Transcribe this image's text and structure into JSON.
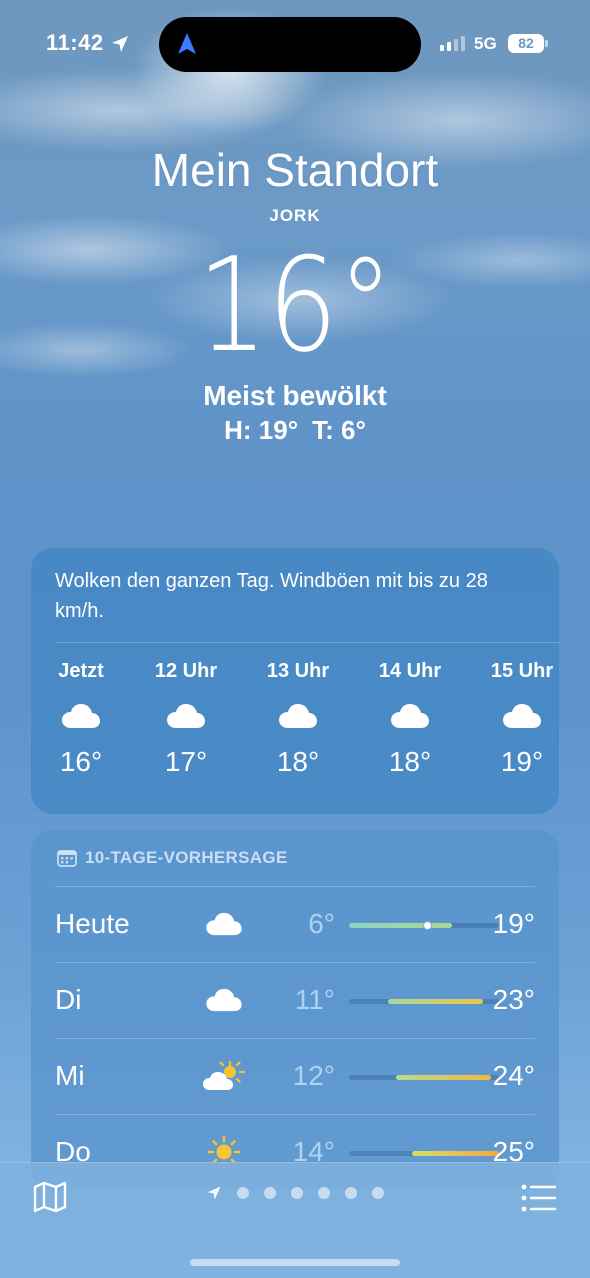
{
  "status": {
    "time": "11:42",
    "network": "5G",
    "battery": "82"
  },
  "header": {
    "location": "Mein Standort",
    "sublocation": "JORK",
    "temperature": "16°",
    "condition": "Meist bewölkt",
    "high": "H: 19°",
    "low": "T: 6°"
  },
  "hourly": {
    "summary": "Wolken den ganzen Tag. Windböen mit bis zu 28 km/h.",
    "items": [
      {
        "label": "Jetzt",
        "icon": "cloud-icon",
        "temp": "16°"
      },
      {
        "label": "12 Uhr",
        "icon": "cloud-icon",
        "temp": "17°"
      },
      {
        "label": "13 Uhr",
        "icon": "cloud-icon",
        "temp": "18°"
      },
      {
        "label": "14 Uhr",
        "icon": "cloud-icon",
        "temp": "18°"
      },
      {
        "label": "15 Uhr",
        "icon": "cloud-icon",
        "temp": "19°"
      }
    ]
  },
  "daily": {
    "title": "10-TAGE-VORHERSAGE",
    "range": {
      "min": 6,
      "max": 25
    },
    "current_temp": 16,
    "items": [
      {
        "day": "Heute",
        "icon": "cloud-icon",
        "low": "6°",
        "high": "19°",
        "lo_v": 6,
        "hi_v": 19,
        "colors": [
          "#8fd3c9",
          "#a7dc8a"
        ]
      },
      {
        "day": "Di",
        "icon": "cloud-icon",
        "low": "11°",
        "high": "23°",
        "lo_v": 11,
        "hi_v": 23,
        "colors": [
          "#a8d99a",
          "#f1c24a"
        ]
      },
      {
        "day": "Mi",
        "icon": "partly-sunny-icon",
        "low": "12°",
        "high": "24°",
        "lo_v": 12,
        "hi_v": 24,
        "colors": [
          "#b6dc8c",
          "#f5b83c"
        ]
      },
      {
        "day": "Do",
        "icon": "sun-icon",
        "low": "14°",
        "high": "25°",
        "lo_v": 14,
        "hi_v": 25,
        "colors": [
          "#d5dc6e",
          "#f5a93a"
        ]
      }
    ]
  },
  "colors": {
    "accent_blue": "#3a7bff",
    "card_hourly": "#4386c4",
    "card_daily": "#5894cc"
  },
  "bottom": {
    "map_icon": "map-icon",
    "list_icon": "list-icon",
    "page_count": 6
  }
}
